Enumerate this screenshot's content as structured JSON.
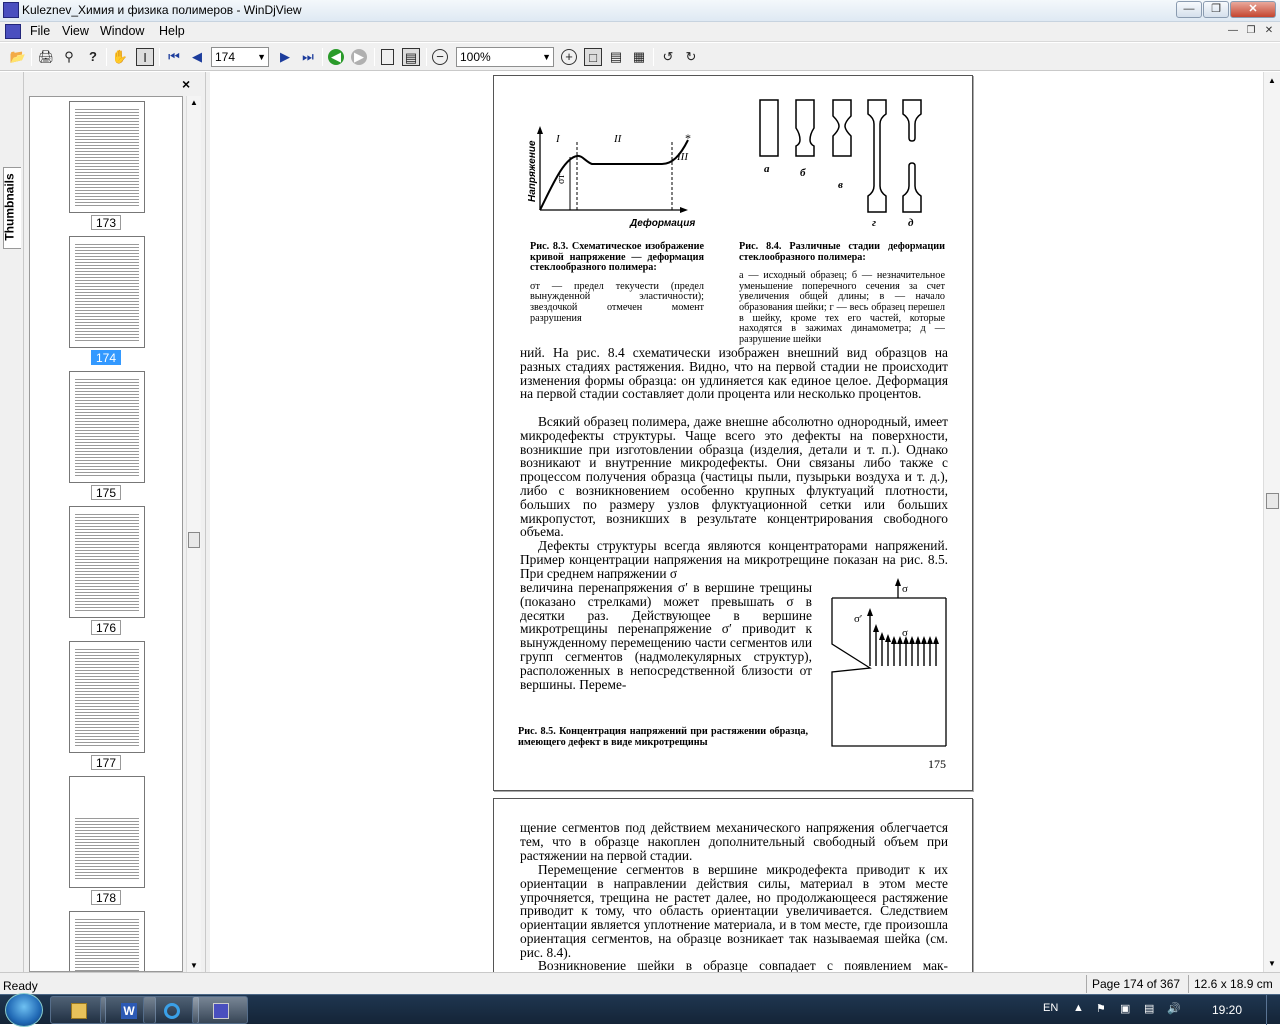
{
  "window": {
    "title": "Kuleznev_Химия и физика полимеров - WinDjView"
  },
  "menu": {
    "items": [
      "File",
      "View",
      "Window",
      "Help"
    ]
  },
  "toolbar": {
    "page_value": "174",
    "zoom_value": "100%"
  },
  "sidebar": {
    "tab_label": "Thumbnails",
    "thumb_numbers": [
      "173",
      "174",
      "175",
      "176",
      "177",
      "178"
    ],
    "selected": "174"
  },
  "page175": {
    "fig83": {
      "stage_I": "I",
      "stage_II": "II",
      "stage_III": "III",
      "sigma_t": "σт",
      "ylabel": "Напряжение",
      "xlabel": "Деформация"
    },
    "fig84": {
      "labels": [
        "а",
        "б",
        "в",
        "г",
        "д"
      ]
    },
    "cap83_title": "Рис. 8.3. Схематическое изображение кривой напряжение — деформация стеклообразного полимера:",
    "cap83_body": "σт — предел текучести (предел вынужденной эластичности); звездочкой отмечен момент разрушения",
    "cap84_title": "Рис. 8.4. Различные стадии деформации стеклообразного полимера:",
    "cap84_body": "а — исходный образец; б — незначительное уменьшение поперечного сечения за счет увеличения общей длины; в — начало образования шейки; г — весь образец перешел в шейку, кроме тех его частей, которые находятся в зажимах динамометра; д — разрушение шейки",
    "para1": "ний. На рис. 8.4 схематически изображен внешний вид образцов на разных стадиях растяжения. Видно, что на первой стадии не происходит изменения формы образца: он удлиняется как единое целое. Деформация на первой стадии составляет доли процента или несколько процентов.",
    "para2": "Всякий образец полимера, даже внешне абсолютно однородный, имеет микродефекты структуры. Чаще всего это дефекты на поверхности, возникшие при изготовлении образца (изделия, детали и т. п.). Однако возникают и внутренние микродефекты. Они связаны либо также с процессом получения образца (частицы пыли, пузырьки воздуха и т. д.), либо с возникновением особенно крупных флуктуаций плотности, больших по размеру узлов флуктуационной сетки или больших микропустот, возникших в результате концентрирования свободного объема.",
    "para3a": "Дефекты структуры всегда являются концентраторами напряжений. Пример концентрации напряжения на микротрещине показан на рис. 8.5. При среднем напряжении σ",
    "para3b": "величина перенапряжения σ′ в вершине трещины (показано стрелками) может превышать σ в десятки раз. Действующее в вершине микротрещины перенапряжение σ′ приводит к вынужденному перемещению части сегментов или групп сегментов (надмолекулярных структур), расположенных в непосредственной близости от вершины. Переме-",
    "fig85": {
      "sigma": "σ",
      "sigma_prime": "σ′",
      "sigma2": "σ"
    },
    "cap85": "Рис. 8.5. Концентрация напряжений при растяжении образца, имеющего дефект в виде микротрещины",
    "page_number": "175"
  },
  "page176": {
    "para1": "щение сегментов под действием механического напряжения облегчается тем, что в образце накоплен дополнительный свободный объем при растяжении на первой стадии.",
    "para2": "Перемещение сегментов в вершине микродефекта приводит к их ориентации в направлении действия силы, материал в этом месте упрочняется, трещина не растет далее, но продолжающееся растяжение приводит к тому, что область ориентации увеличивается. Следствием ориентации является уплотнение материала, и в том месте, где произошла ориентация сегментов, на образце возникает так называемая шейка (см. рис. 8.4).",
    "para3": "Возникновение шейки в образце совпадает с появлением мак-"
  },
  "status": {
    "ready": "Ready",
    "page_info": "Page 174 of 367",
    "page_size": "12.6 x 18.9 cm"
  },
  "taskbar": {
    "lang": "EN",
    "time": "19:20"
  }
}
